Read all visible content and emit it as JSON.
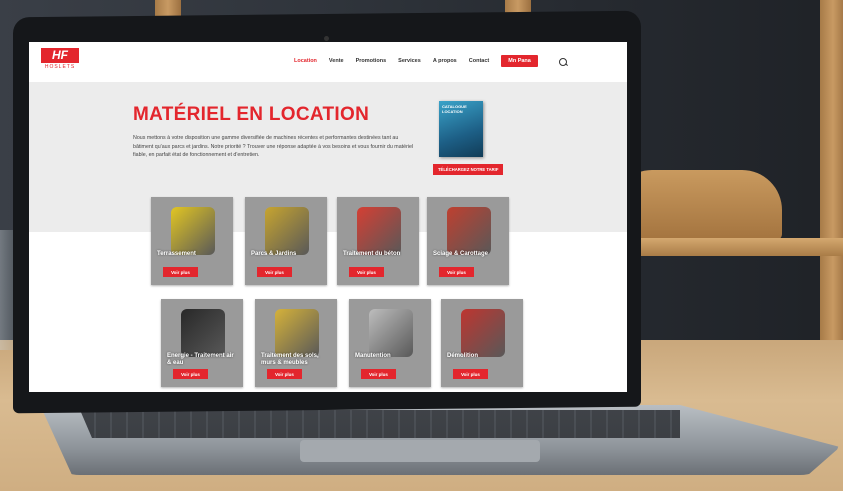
{
  "site": {
    "logo_mark": "HF",
    "logo_sub": "HOSLETS",
    "nav": [
      "Location",
      "Vente",
      "Promotions",
      "Services",
      "A propos",
      "Contact"
    ],
    "nav_button": "Mn Pana"
  },
  "hero": {
    "title": "MATÉRIEL EN LOCATION",
    "text": "Nous mettons à votre disposition une gamme diversifiée de machines récentes et performantes destinées tant au bâtiment qu'aux parcs et jardins. Notre priorité ? Trouver une réponse adaptée à vos besoins et vous fournir du matériel fiable, en parfait état de fonctionnement et d'entretien.",
    "catalog_title": "CATALOGUE LOCATION",
    "catalog_button": "TÉLÉCHARGEZ NOTRE TARIF"
  },
  "cards": [
    {
      "label": "Terrassement",
      "button": "Voir plus",
      "color": "#e6c81c"
    },
    {
      "label": "Parcs & Jardins",
      "button": "Voir plus",
      "color": "#c9a52a"
    },
    {
      "label": "Traitement du béton",
      "button": "Voir plus",
      "color": "#d83a2e"
    },
    {
      "label": "Sciage & Carottage",
      "button": "Voir plus",
      "color": "#c13b2a"
    },
    {
      "label": "Energie - Traitement air & eau",
      "button": "Voir plus",
      "color": "#222222"
    },
    {
      "label": "Traitement des sols, murs & meubles",
      "button": "Voir plus",
      "color": "#d8b335"
    },
    {
      "label": "Manutention",
      "button": "Voir plus",
      "color": "#bfbfbf"
    },
    {
      "label": "Démolition",
      "button": "Voir plus",
      "color": "#c0302a"
    }
  ],
  "colors": {
    "accent": "#e3262d"
  }
}
